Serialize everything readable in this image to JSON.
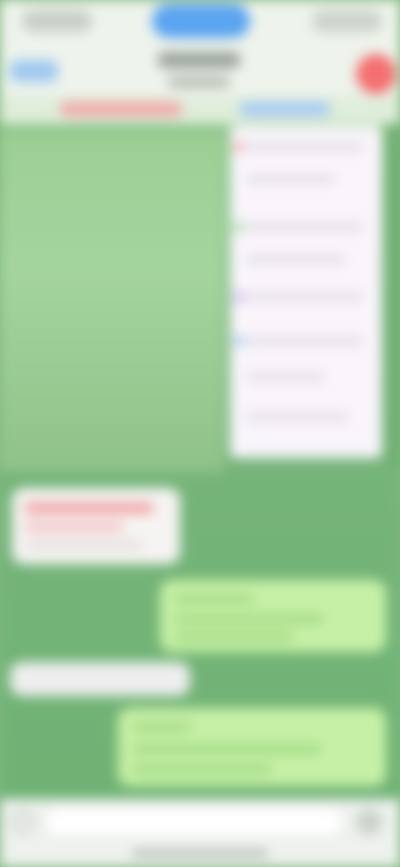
{
  "colors": {
    "chat_background": "#7fb77f",
    "accent_blue": "#5aa4f0",
    "avatar_red": "#f36f6f",
    "outgoing_bubble": "#c6f0a6",
    "incoming_bubble": "#f6f4f3"
  },
  "icons": {
    "back": "chevron-left-icon",
    "avatar": "avatar",
    "attach": "paperclip-icon",
    "mic": "microphone-icon"
  }
}
